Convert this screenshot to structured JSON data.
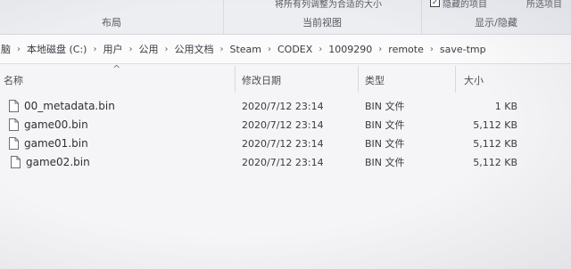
{
  "ribbon": {
    "cut_text_left": "将所有列调整为合适的大小",
    "cut_text_right_1": "隐藏的项目",
    "cut_text_right_2": "所选项目",
    "groups": [
      {
        "label": "布局"
      },
      {
        "label": "当前视图"
      },
      {
        "label": "显示/隐藏"
      }
    ]
  },
  "breadcrumb": {
    "separator": "›",
    "items": [
      "脑",
      "本地磁盘 (C:)",
      "用户",
      "公用",
      "公用文档",
      "Steam",
      "CODEX",
      "1009290",
      "remote",
      "save-tmp"
    ]
  },
  "sort_arrow": "^",
  "columns": {
    "name": "名称",
    "modified": "修改日期",
    "type": "类型",
    "size": "大小"
  },
  "files": [
    {
      "name": "00_metadata.bin",
      "modified": "2020/7/12 23:14",
      "type": "BIN 文件",
      "size": "1 KB"
    },
    {
      "name": "game00.bin",
      "modified": "2020/7/12 23:14",
      "type": "BIN 文件",
      "size": "5,112 KB"
    },
    {
      "name": "game01.bin",
      "modified": "2020/7/12 23:14",
      "type": "BIN 文件",
      "size": "5,112 KB"
    },
    {
      "name": "game02.bin",
      "modified": "2020/7/12 23:14",
      "type": "BIN 文件",
      "size": "5,112 KB"
    }
  ]
}
